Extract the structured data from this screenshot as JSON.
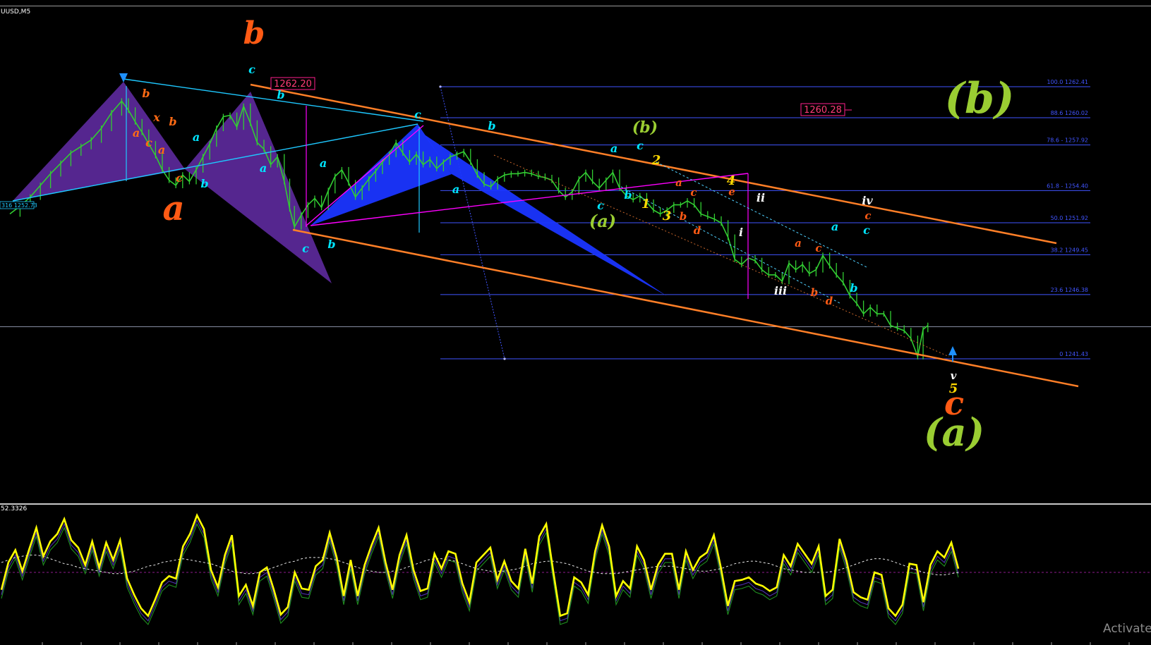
{
  "window": {
    "symbol_label": "UUSD,M5"
  },
  "chart_data": {
    "type": "line",
    "title": "",
    "instrument_label": "UUSD,M5",
    "ylim": [
      1238.0,
      1265.0
    ],
    "price_series": [
      [
        0,
        1252.6
      ],
      [
        15,
        1253.2
      ],
      [
        30,
        1253.9
      ],
      [
        45,
        1254.8
      ],
      [
        60,
        1255.7
      ],
      [
        75,
        1256.5
      ],
      [
        90,
        1257.3
      ],
      [
        105,
        1257.8
      ],
      [
        120,
        1258.3
      ],
      [
        135,
        1259.2
      ],
      [
        150,
        1260.4
      ],
      [
        165,
        1261.3
      ],
      [
        175,
        1260.6
      ],
      [
        185,
        1259.7
      ],
      [
        195,
        1258.9
      ],
      [
        205,
        1258.0
      ],
      [
        215,
        1257.1
      ],
      [
        225,
        1256.0
      ],
      [
        235,
        1255.2
      ],
      [
        245,
        1254.8
      ],
      [
        255,
        1255.6
      ],
      [
        265,
        1255.1
      ],
      [
        275,
        1256.0
      ],
      [
        285,
        1257.0
      ],
      [
        295,
        1258.0
      ],
      [
        305,
        1259.2
      ],
      [
        315,
        1260.1
      ],
      [
        325,
        1260.2
      ],
      [
        335,
        1259.3
      ],
      [
        345,
        1260.9
      ],
      [
        355,
        1259.6
      ],
      [
        365,
        1258.1
      ],
      [
        375,
        1257.6
      ],
      [
        385,
        1256.4
      ],
      [
        395,
        1257.0
      ],
      [
        405,
        1255.1
      ],
      [
        413,
        1253.0
      ],
      [
        420,
        1251.6
      ],
      [
        430,
        1252.5
      ],
      [
        440,
        1253.3
      ],
      [
        450,
        1253.8
      ],
      [
        460,
        1253.1
      ],
      [
        470,
        1254.4
      ],
      [
        480,
        1255.5
      ],
      [
        490,
        1256.0
      ],
      [
        500,
        1255.0
      ],
      [
        510,
        1253.9
      ],
      [
        520,
        1254.6
      ],
      [
        530,
        1255.3
      ],
      [
        540,
        1255.9
      ],
      [
        550,
        1256.6
      ],
      [
        560,
        1257.2
      ],
      [
        570,
        1258.1
      ],
      [
        580,
        1257.3
      ],
      [
        590,
        1256.6
      ],
      [
        600,
        1257.2
      ],
      [
        610,
        1256.4
      ],
      [
        620,
        1256.8
      ],
      [
        630,
        1256.1
      ],
      [
        640,
        1256.6
      ],
      [
        650,
        1257.0
      ],
      [
        660,
        1257.2
      ],
      [
        670,
        1257.4
      ],
      [
        680,
        1256.6
      ],
      [
        690,
        1255.6
      ],
      [
        700,
        1254.9
      ],
      [
        710,
        1254.7
      ],
      [
        720,
        1255.3
      ],
      [
        730,
        1255.6
      ],
      [
        740,
        1255.7
      ],
      [
        750,
        1255.7
      ],
      [
        760,
        1255.8
      ],
      [
        770,
        1255.7
      ],
      [
        780,
        1255.5
      ],
      [
        790,
        1255.4
      ],
      [
        800,
        1255.2
      ],
      [
        810,
        1254.4
      ],
      [
        820,
        1253.9
      ],
      [
        830,
        1254.3
      ],
      [
        840,
        1255.3
      ],
      [
        850,
        1255.8
      ],
      [
        860,
        1255.1
      ],
      [
        870,
        1254.6
      ],
      [
        880,
        1255.2
      ],
      [
        890,
        1255.8
      ],
      [
        900,
        1254.6
      ],
      [
        910,
        1254.0
      ],
      [
        920,
        1253.7
      ],
      [
        930,
        1254.0
      ],
      [
        940,
        1253.5
      ],
      [
        950,
        1252.9
      ],
      [
        960,
        1252.6
      ],
      [
        970,
        1252.9
      ],
      [
        980,
        1253.3
      ],
      [
        990,
        1253.3
      ],
      [
        1000,
        1253.6
      ],
      [
        1010,
        1253.3
      ],
      [
        1020,
        1252.6
      ],
      [
        1030,
        1252.4
      ],
      [
        1040,
        1252.2
      ],
      [
        1050,
        1251.9
      ],
      [
        1060,
        1250.8
      ],
      [
        1070,
        1249.1
      ],
      [
        1080,
        1248.7
      ],
      [
        1090,
        1249.2
      ],
      [
        1100,
        1249.0
      ],
      [
        1110,
        1248.3
      ],
      [
        1120,
        1247.9
      ],
      [
        1130,
        1247.9
      ],
      [
        1140,
        1247.4
      ],
      [
        1150,
        1248.8
      ],
      [
        1160,
        1248.3
      ],
      [
        1170,
        1248.7
      ],
      [
        1180,
        1248.0
      ],
      [
        1190,
        1248.3
      ],
      [
        1200,
        1249.4
      ],
      [
        1210,
        1248.6
      ],
      [
        1220,
        1247.9
      ],
      [
        1230,
        1247.3
      ],
      [
        1240,
        1246.3
      ],
      [
        1250,
        1245.7
      ],
      [
        1260,
        1244.9
      ],
      [
        1270,
        1245.4
      ],
      [
        1280,
        1244.9
      ],
      [
        1290,
        1244.9
      ],
      [
        1300,
        1244.0
      ],
      [
        1310,
        1243.8
      ],
      [
        1320,
        1243.6
      ],
      [
        1330,
        1243.0
      ],
      [
        1340,
        1241.6
      ],
      [
        1348,
        1243.7
      ],
      [
        1355,
        1244.0
      ]
    ],
    "fibonacci_levels": [
      {
        "label": "100.0 1262.41",
        "price": 1262.41
      },
      {
        "label": "88.6 1260.02",
        "price": 1260.02
      },
      {
        "label": "78.6 - 1257.92",
        "price": 1257.92
      },
      {
        "label": "61.8 - 1254.40",
        "price": 1254.4
      },
      {
        "label": "50.0 1251.92",
        "price": 1251.92
      },
      {
        "label": "38.2 1249.45",
        "price": 1249.45
      },
      {
        "label": "23.6 1246.38",
        "price": 1246.38
      },
      {
        "label": "0 1241.43",
        "price": 1241.43
      }
    ],
    "price_boxes": [
      {
        "text": "1262.20",
        "price": 1262.2
      },
      {
        "text": "1260.28",
        "price": 1260.28
      }
    ],
    "left_price_tag": "316 1252.73",
    "current_price_line": 1243.9,
    "wave_labels": [
      {
        "text": "b",
        "color": "#ff5a14"
      },
      {
        "text": "a",
        "color": "#ff5a14"
      },
      {
        "text": "c",
        "color": "#ff5a14"
      },
      {
        "text": "(b)",
        "color": "#9acd32"
      },
      {
        "text": "(a)",
        "color": "#9acd32"
      },
      {
        "text": "(a)",
        "color": "#9acd32"
      },
      {
        "text": "(b)",
        "color": "#9acd32"
      },
      {
        "text": "c",
        "color": "#00e5ff"
      },
      {
        "text": "b",
        "color": "#00e5ff"
      },
      {
        "text": "b",
        "color": "#ff6a14"
      },
      {
        "text": "a",
        "color": "#ff6a14"
      },
      {
        "text": "x",
        "color": "#ff6a14"
      },
      {
        "text": "b",
        "color": "#ff6a14"
      },
      {
        "text": "c",
        "color": "#ff6a14"
      },
      {
        "text": "a",
        "color": "#ff6a14"
      },
      {
        "text": "a",
        "color": "#00e5ff"
      },
      {
        "text": "c",
        "color": "#ff6a14"
      },
      {
        "text": "b",
        "color": "#00e5ff"
      },
      {
        "text": "a",
        "color": "#00e5ff"
      },
      {
        "text": "a",
        "color": "#00e5ff"
      },
      {
        "text": "c",
        "color": "#00e5ff"
      },
      {
        "text": "b",
        "color": "#00e5ff"
      },
      {
        "text": "a",
        "color": "#00e5ff"
      },
      {
        "text": "c",
        "color": "#00e5ff"
      },
      {
        "text": "b",
        "color": "#00e5ff"
      },
      {
        "text": "a",
        "color": "#00e5ff"
      },
      {
        "text": "c",
        "color": "#00e5ff"
      },
      {
        "text": "c",
        "color": "#00e5ff"
      },
      {
        "text": "b",
        "color": "#00e5ff"
      },
      {
        "text": "2",
        "color": "#ffd700"
      },
      {
        "text": "1",
        "color": "#ffd700"
      },
      {
        "text": "3",
        "color": "#ffd700"
      },
      {
        "text": "4",
        "color": "#ffd700"
      },
      {
        "text": "5",
        "color": "#ffd700"
      },
      {
        "text": "a",
        "color": "#ff5a14"
      },
      {
        "text": "c",
        "color": "#ff5a14"
      },
      {
        "text": "b",
        "color": "#ff5a14"
      },
      {
        "text": "d",
        "color": "#ff5a14"
      },
      {
        "text": "e",
        "color": "#ff5a14"
      },
      {
        "text": "ii",
        "color": "#ffffff"
      },
      {
        "text": "i",
        "color": "#ffffff"
      },
      {
        "text": "iii",
        "color": "#ffffff"
      },
      {
        "text": "iv",
        "color": "#ffffff"
      },
      {
        "text": "v",
        "color": "#ffffff"
      },
      {
        "text": "a",
        "color": "#00e5ff"
      },
      {
        "text": "c",
        "color": "#00e5ff"
      },
      {
        "text": "b",
        "color": "#00e5ff"
      },
      {
        "text": "a",
        "color": "#ff5a14"
      },
      {
        "text": "c",
        "color": "#ff5a14"
      },
      {
        "text": "b",
        "color": "#ff5a14"
      },
      {
        "text": "d",
        "color": "#ff5a14"
      },
      {
        "text": "c",
        "color": "#ff5a14"
      }
    ],
    "oscillator": {
      "label": "52.3326",
      "ylim": [
        0,
        100
      ],
      "main_color": "#ffff00",
      "signal_colors": [
        "#4f2fb0",
        "#1f8f1f"
      ],
      "middle_line": 50,
      "values": [
        36,
        58,
        68,
        51,
        69,
        86,
        63,
        75,
        81,
        93,
        76,
        70,
        56,
        75,
        54,
        74,
        60,
        76,
        45,
        32,
        21,
        15,
        28,
        42,
        47,
        45,
        71,
        81,
        96,
        85,
        52,
        38,
        64,
        80,
        31,
        40,
        23,
        50,
        54,
        36,
        16,
        22,
        50,
        37,
        36,
        55,
        60,
        82,
        62,
        31,
        60,
        31,
        56,
        72,
        86,
        58,
        36,
        64,
        80,
        52,
        35,
        37,
        65,
        53,
        67,
        65,
        41,
        26,
        58,
        64,
        70,
        44,
        59,
        43,
        37,
        69,
        41,
        79,
        89,
        51,
        15,
        17,
        46,
        42,
        32,
        67,
        88,
        71,
        31,
        43,
        37,
        71,
        60,
        36,
        56,
        65,
        65,
        36,
        67,
        52,
        62,
        66,
        80,
        54,
        23,
        43,
        44,
        46,
        41,
        39,
        35,
        38,
        64,
        55,
        73,
        65,
        57,
        71,
        31,
        36,
        77,
        59,
        34,
        30,
        28,
        50,
        48,
        21,
        15,
        24,
        57,
        56,
        26,
        56,
        67,
        62,
        74,
        53
      ]
    },
    "oscillator_signal_line": [
      58,
      60,
      62,
      63,
      64,
      64,
      63,
      61,
      59,
      57,
      56,
      54,
      53,
      52,
      51,
      50,
      49,
      49,
      50,
      51,
      53,
      55,
      56,
      58,
      59,
      60,
      61,
      60,
      59,
      58,
      57,
      55,
      53,
      51,
      50,
      49,
      49,
      50,
      52,
      54,
      56,
      58,
      59,
      61,
      62,
      62,
      62,
      61,
      60,
      58,
      56,
      54,
      52,
      51,
      50,
      50,
      51,
      52,
      54,
      56,
      58,
      60,
      61,
      61,
      60,
      59,
      57,
      55,
      53,
      52,
      51,
      51,
      51,
      52,
      53,
      55,
      57,
      58,
      59,
      59,
      58,
      57,
      55,
      53,
      51,
      50,
      49,
      49,
      49,
      50,
      51,
      52,
      53,
      54,
      55,
      55,
      55,
      54,
      53,
      52,
      51,
      51,
      52,
      53,
      55,
      57,
      58,
      59,
      59,
      58,
      57,
      55,
      53,
      52,
      51,
      50,
      50,
      50,
      50,
      51,
      52,
      54,
      56,
      58,
      60,
      61,
      61,
      60,
      58,
      56,
      54,
      52,
      50,
      49,
      48,
      48,
      49,
      50
    ],
    "colors": {
      "candles": "#32cd32",
      "channel": "#ff7f27",
      "fib": "#4155ff",
      "pattern_purple": "#5e2a9e",
      "pattern_blue": "#1a35ff",
      "magenta": "#ff00ff",
      "cyan_line": "#1ec8ff",
      "box_border": "#ff1e8c"
    }
  },
  "watermark": "Activate"
}
